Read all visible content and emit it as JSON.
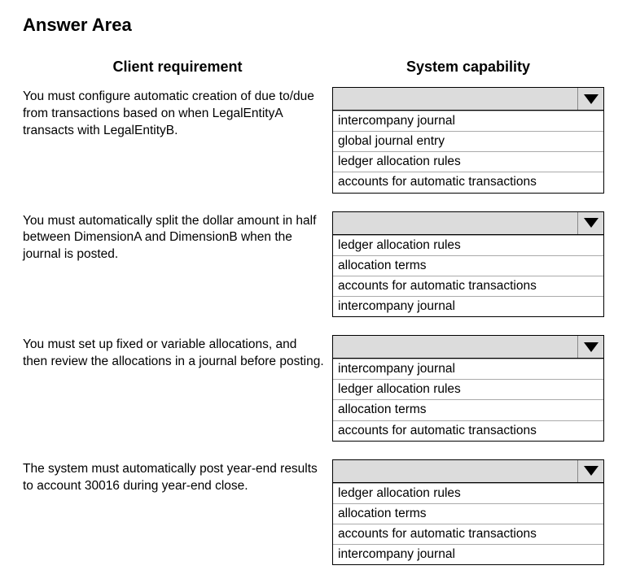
{
  "title": "Answer Area",
  "headers": {
    "left": "Client requirement",
    "right": "System capability"
  },
  "items": [
    {
      "requirement": "You must configure automatic creation of due to/due from transactions based on when LegalEntityA transacts with LegalEntityB.",
      "options": [
        "intercompany journal",
        "global journal entry",
        "ledger allocation rules",
        "accounts for automatic transactions"
      ]
    },
    {
      "requirement": "You must automatically split the dollar amount in half between DimensionA and DimensionB when the journal is posted.",
      "options": [
        "ledger allocation rules",
        "allocation terms",
        "accounts for automatic transactions",
        "intercompany journal"
      ]
    },
    {
      "requirement": "You must set up fixed or variable allocations, and then review the allocations in a journal before posting.",
      "options": [
        "intercompany journal",
        "ledger allocation rules",
        "allocation terms",
        "accounts for automatic transactions"
      ]
    },
    {
      "requirement": "The system must automatically post year-end results to account 30016 during year-end close.",
      "options": [
        "ledger allocation rules",
        "allocation terms",
        "accounts for automatic transactions",
        "intercompany journal"
      ]
    }
  ]
}
